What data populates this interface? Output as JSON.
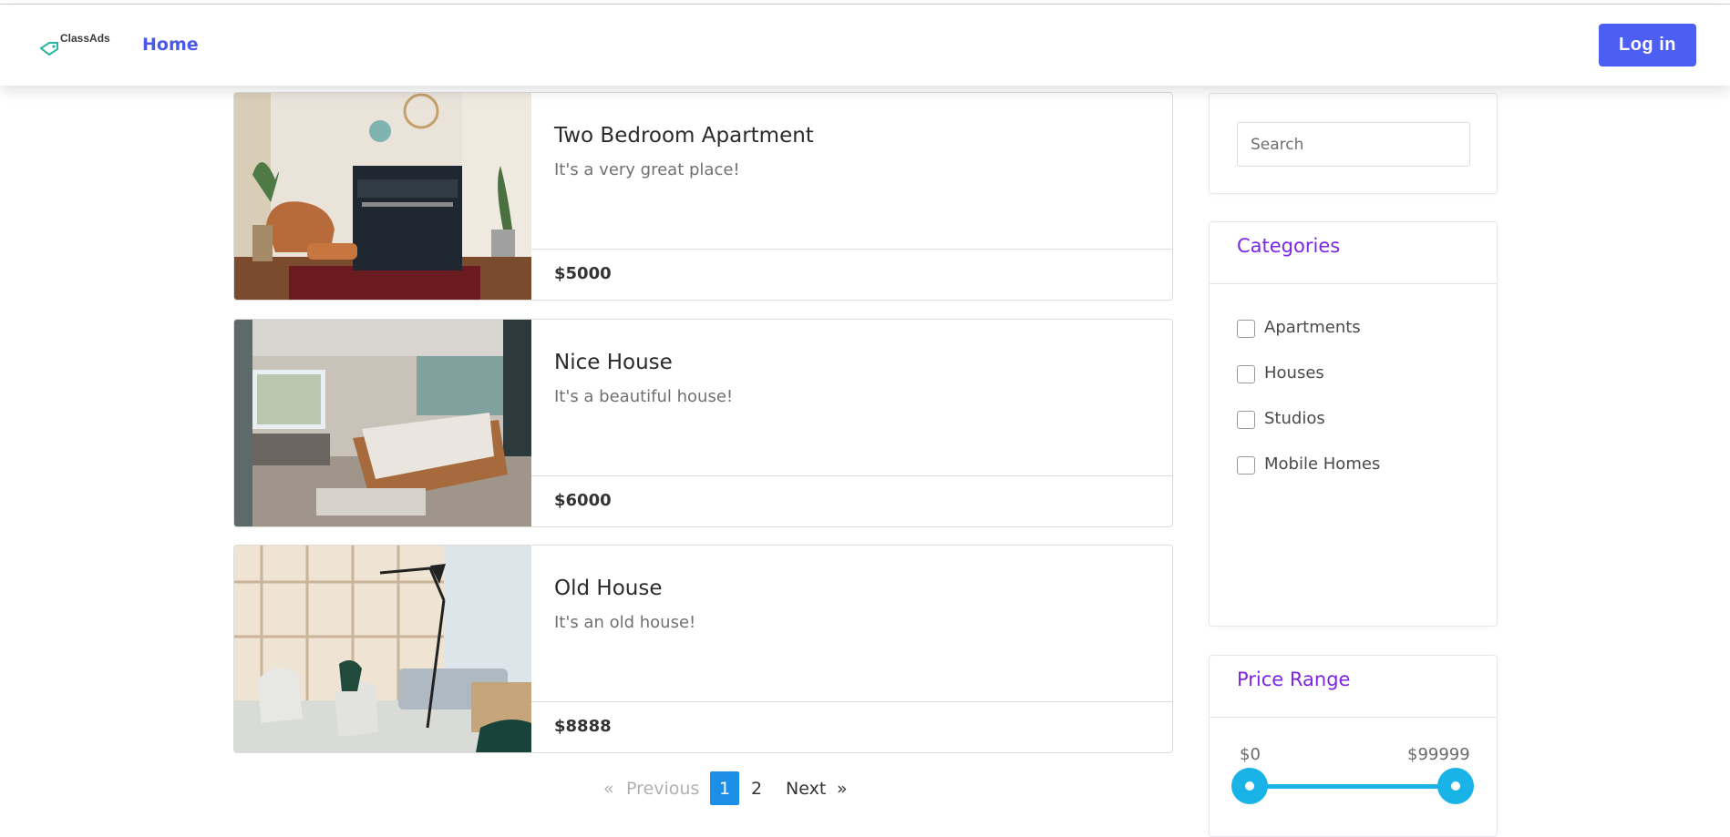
{
  "header": {
    "logo_text": "ClassAds",
    "nav_home": "Home",
    "login_label": "Log in",
    "accent_color": "#4c5ff2"
  },
  "listings": [
    {
      "title": "Two Bedroom Apartment",
      "description": "It's a very great place!",
      "price": "$5000",
      "image_icon": "living-room-piano-photo"
    },
    {
      "title": "Nice House",
      "description": "It's a beautiful house!",
      "price": "$6000",
      "image_icon": "bedroom-photo"
    },
    {
      "title": "Old House",
      "description": "It's an old house!",
      "price": "$8888",
      "image_icon": "lounge-chairs-photo"
    }
  ],
  "pagination": {
    "prev_symbol": "«",
    "prev_label": "Previous",
    "pages": [
      "1",
      "2"
    ],
    "current_page": "1",
    "next_label": "Next",
    "next_symbol": "»",
    "active_color": "#1d8fe6"
  },
  "sidebar": {
    "search_placeholder": "Search",
    "categories_title": "Categories",
    "categories": [
      "Apartments",
      "Houses",
      "Studios",
      "Mobile Homes"
    ],
    "price_title": "Price Range",
    "price_min": "$0",
    "price_max": "$99999",
    "slider_color": "#19b3e8",
    "title_color": "#7b26e8"
  }
}
